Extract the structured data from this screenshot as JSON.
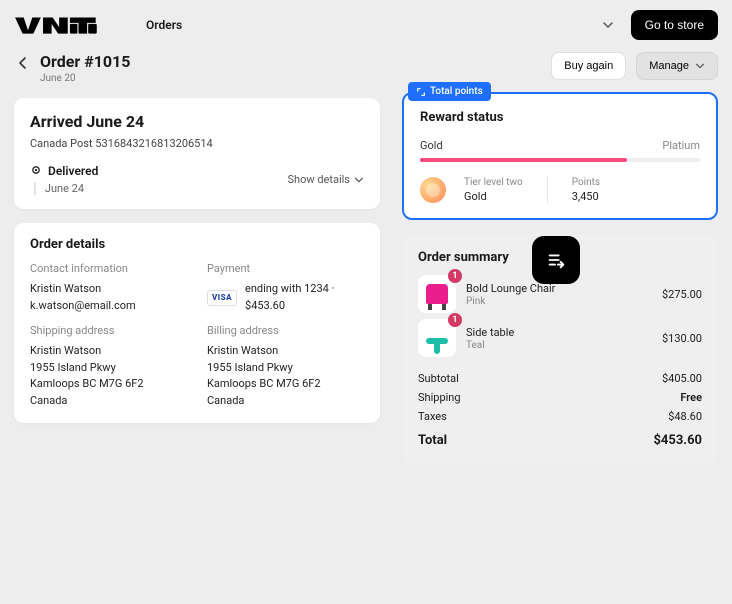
{
  "topbar": {
    "brand": "VNTI",
    "nav_orders": "Orders",
    "go_store": "Go to store"
  },
  "header": {
    "title": "Order #1015",
    "date": "June 20",
    "buy_again": "Buy again",
    "manage": "Manage"
  },
  "shipment": {
    "arrived_title": "Arrived June 24",
    "tracking": "Canada Post 5316843216813206514",
    "status": "Delivered",
    "status_date": "June 24",
    "show_details": "Show details"
  },
  "details": {
    "section_title": "Order details",
    "contact_label": "Contact information",
    "contact_name": "Kristin Watson",
    "contact_email": "k.watson@email.com",
    "shipping_label": "Shipping address",
    "shipping_name": "Kristin Watson",
    "shipping_l1": "1955 Island Pkwy",
    "shipping_l2": "Kamloops BC M7G 6F2",
    "shipping_country": "Canada",
    "payment_label": "Payment",
    "payment_brand": "VISA",
    "payment_text": "ending with 1234 · $453.60",
    "billing_label": "Billing address",
    "billing_name": "Kristin Watson",
    "billing_l1": "1955 Island Pkwy",
    "billing_l2": "Kamloops BC M7G 6F2",
    "billing_country": "Canada"
  },
  "reward": {
    "pill": "Total points",
    "title": "Reward status",
    "tier_from": "Gold",
    "tier_to": "Platium",
    "tier_level_label": "Tier level two",
    "tier_level_val": "Gold",
    "points_label": "Points",
    "points_val": "3,450"
  },
  "summary": {
    "title": "Order summary",
    "items": [
      {
        "qty": "1",
        "name": "Bold Lounge Chair",
        "variant": "Pink",
        "price": "$275.00"
      },
      {
        "qty": "1",
        "name": "Side table",
        "variant": "Teal",
        "price": "$130.00"
      }
    ],
    "subtotal_label": "Subtotal",
    "subtotal_val": "$405.00",
    "shipping_label": "Shipping",
    "shipping_val": "Free",
    "taxes_label": "Taxes",
    "taxes_val": "$48.60",
    "total_label": "Total",
    "total_val": "$453.60"
  }
}
